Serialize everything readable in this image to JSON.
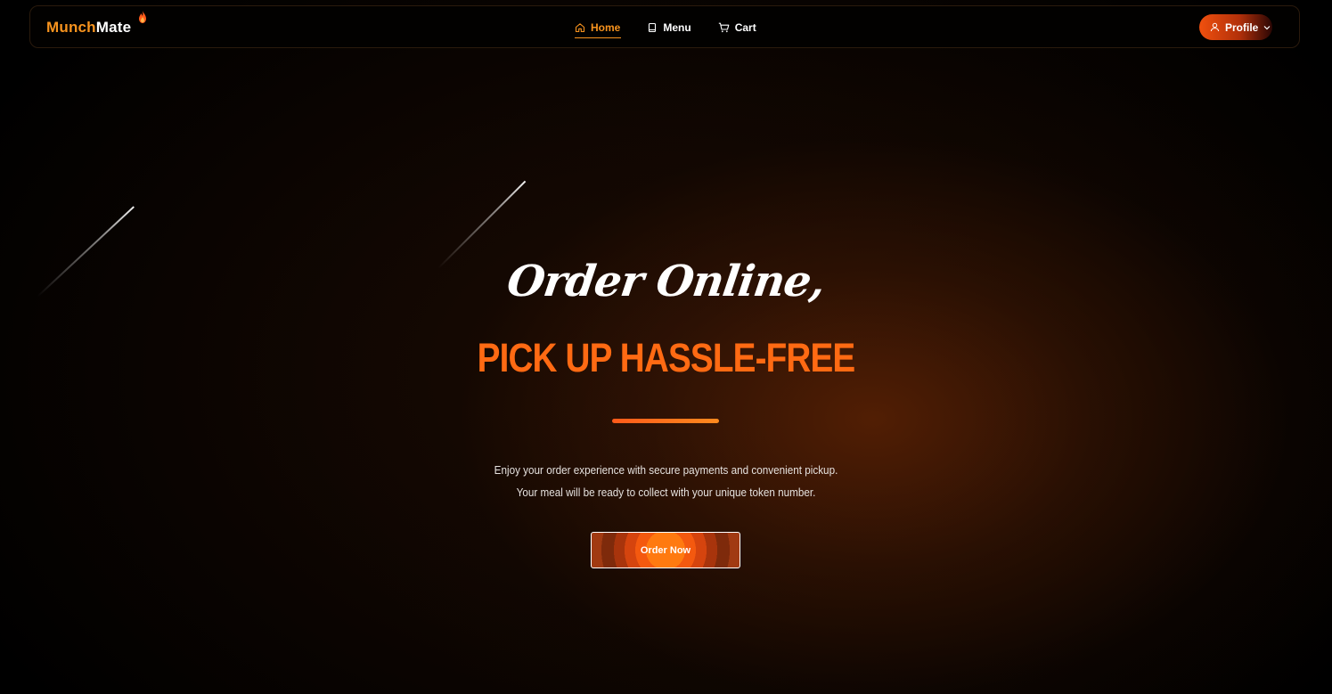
{
  "brand": {
    "name_part1": "Munch",
    "name_part2": "Mate",
    "accent_color": "#f7931e",
    "flame_icon": "flame-icon"
  },
  "nav": {
    "items": [
      {
        "label": "Home",
        "icon": "home-icon",
        "active": true
      },
      {
        "label": "Menu",
        "icon": "book-icon",
        "active": false
      },
      {
        "label": "Cart",
        "icon": "cart-icon",
        "active": false
      }
    ],
    "profile": {
      "label": "Profile",
      "icon": "user-icon",
      "chevron": "chevron-down-icon"
    }
  },
  "hero": {
    "script_line": "Order Online,",
    "title": "PICK UP HASSLE-FREE",
    "title_color": "#ff6a13",
    "description_line1": "Enjoy your order experience with secure payments and convenient pickup.",
    "description_line2": "Your meal will be ready to collect with your unique token number.",
    "cta_label": "Order Now"
  }
}
